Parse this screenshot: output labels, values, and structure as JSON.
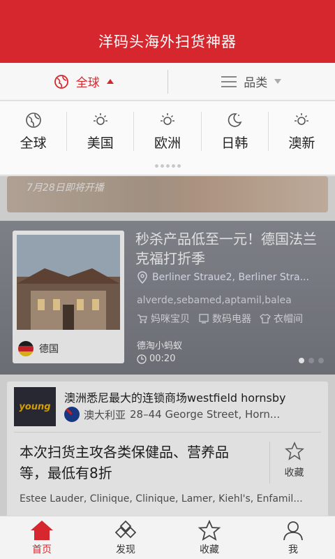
{
  "app": {
    "title": "洋码头海外扫货神器"
  },
  "filter": {
    "region_label": "全球",
    "category_label": "品类"
  },
  "regions": [
    {
      "label": "全球",
      "icon": "globe-icon"
    },
    {
      "label": "美国",
      "icon": "sun-icon"
    },
    {
      "label": "欧洲",
      "icon": "sun-icon"
    },
    {
      "label": "日韩",
      "icon": "moon-icon"
    },
    {
      "label": "澳新",
      "icon": "sun-icon"
    }
  ],
  "banner": {
    "text": "7月28日即将开播"
  },
  "sale": {
    "title": "秒杀产品低至一元！德国法兰克福打折季",
    "address": "Berliner Straue2, Berliner Stra...",
    "brands": "alverde,sebamed,aptamil,balea",
    "categories": [
      "妈咪宝贝",
      "数码电器",
      "衣帽间"
    ],
    "country": "德国",
    "author": "德淘小蚂蚁",
    "time": "00:20"
  },
  "mall": {
    "name": "澳洲悉尼最大的连锁商场westfield hornsby",
    "country": "澳大利亚",
    "address": "28–44 George Street, Horn...",
    "description": "本次扫货主攻各类保健品、营养品等，最低有8折",
    "favorite_label": "收藏",
    "brands": "Estee Lauder, Clinique, Clinique, Lamer, Kiehl's, Enfamil..."
  },
  "nav": [
    {
      "label": "首页",
      "icon": "home-icon"
    },
    {
      "label": "发现",
      "icon": "discover-icon"
    },
    {
      "label": "收藏",
      "icon": "star-icon"
    },
    {
      "label": "我",
      "icon": "user-icon"
    }
  ],
  "colors": {
    "brand_red": "#d6272e"
  }
}
